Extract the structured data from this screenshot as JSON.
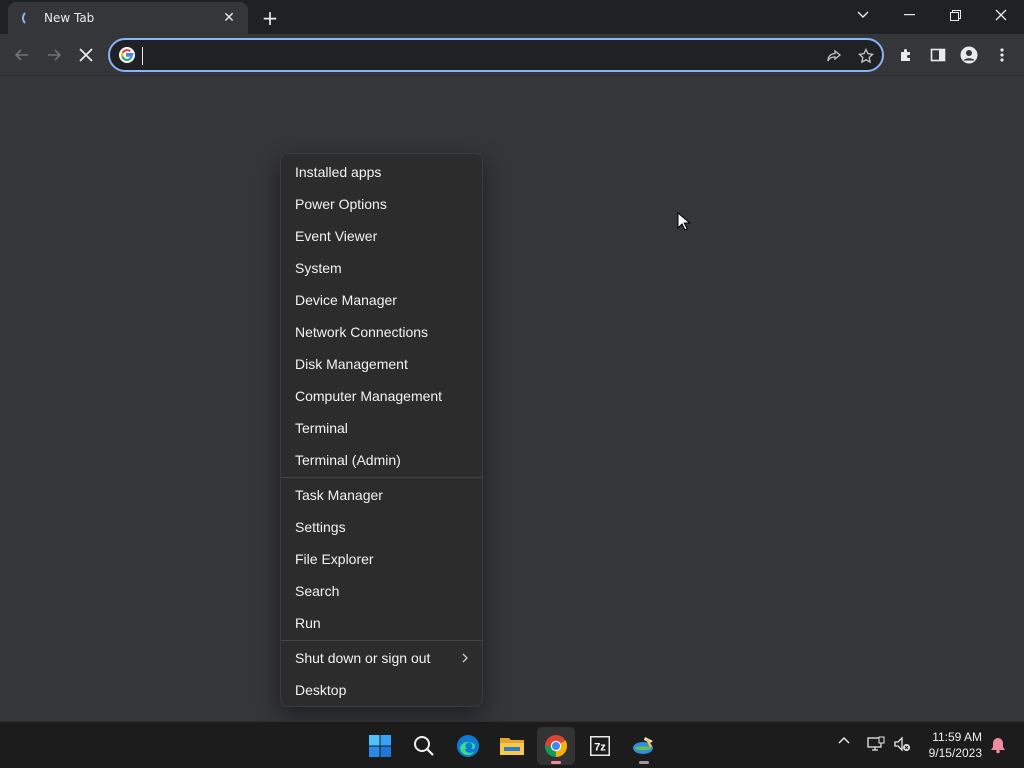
{
  "browser": {
    "tab": {
      "title": "New Tab",
      "close_glyph": "✕"
    },
    "new_tab_glyph": "+",
    "omnibox": {
      "value": "",
      "placeholder": ""
    }
  },
  "context_menu": {
    "groups": [
      [
        "Installed apps",
        "Power Options",
        "Event Viewer",
        "System",
        "Device Manager",
        "Network Connections",
        "Disk Management",
        "Computer Management",
        "Terminal",
        "Terminal (Admin)"
      ],
      [
        "Task Manager",
        "Settings",
        "File Explorer",
        "Search",
        "Run"
      ],
      [
        "Shut down or sign out",
        "Desktop"
      ]
    ],
    "submenu_item": "Shut down or sign out"
  },
  "taskbar": {
    "apps": [
      "start-icon",
      "search-icon",
      "edge-icon",
      "file-explorer-icon",
      "chrome-icon",
      "7zip-icon",
      "network-app-icon"
    ],
    "active_app": "chrome-icon",
    "zip_label": "7z"
  },
  "clock": {
    "time": "11:59 AM",
    "date": "9/15/2023"
  },
  "colors": {
    "accent": "#8ab4f8",
    "background": "#35363a",
    "menu": "#2c2c2c",
    "taskbar": "#1c1c1c"
  }
}
